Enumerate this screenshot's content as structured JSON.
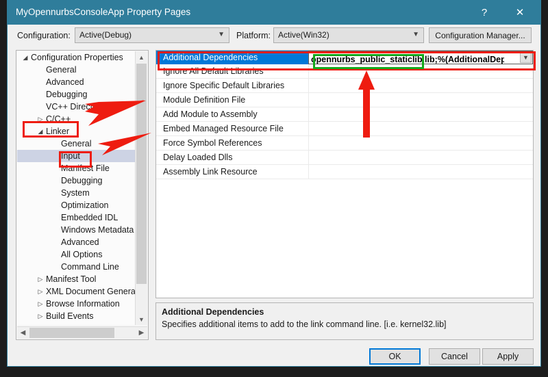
{
  "window": {
    "title": "MyOpennurbsConsoleApp Property Pages",
    "help_icon": "question-mark-icon",
    "close_icon": "close-x-icon"
  },
  "config_bar": {
    "configuration_label": "Configuration:",
    "configuration_value": "Active(Debug)",
    "platform_label": "Platform:",
    "platform_value": "Active(Win32)",
    "configuration_manager_button": "Configuration Manager...",
    "dropdown_icon": "chevron-down-icon"
  },
  "tree": {
    "items": [
      {
        "label": "Configuration Properties",
        "indent": 0,
        "expander": "expanded",
        "selected": false
      },
      {
        "label": "General",
        "indent": 1,
        "expander": "none",
        "selected": false
      },
      {
        "label": "Advanced",
        "indent": 1,
        "expander": "none",
        "selected": false
      },
      {
        "label": "Debugging",
        "indent": 1,
        "expander": "none",
        "selected": false
      },
      {
        "label": "VC++ Directories",
        "indent": 1,
        "expander": "none",
        "selected": false
      },
      {
        "label": "C/C++",
        "indent": 1,
        "expander": "collapsed",
        "selected": false
      },
      {
        "label": "Linker",
        "indent": 1,
        "expander": "expanded",
        "selected": false
      },
      {
        "label": "General",
        "indent": 2,
        "expander": "none",
        "selected": false
      },
      {
        "label": "Input",
        "indent": 2,
        "expander": "none",
        "selected": true
      },
      {
        "label": "Manifest File",
        "indent": 2,
        "expander": "none",
        "selected": false
      },
      {
        "label": "Debugging",
        "indent": 2,
        "expander": "none",
        "selected": false
      },
      {
        "label": "System",
        "indent": 2,
        "expander": "none",
        "selected": false
      },
      {
        "label": "Optimization",
        "indent": 2,
        "expander": "none",
        "selected": false
      },
      {
        "label": "Embedded IDL",
        "indent": 2,
        "expander": "none",
        "selected": false
      },
      {
        "label": "Windows Metadata",
        "indent": 2,
        "expander": "none",
        "selected": false
      },
      {
        "label": "Advanced",
        "indent": 2,
        "expander": "none",
        "selected": false
      },
      {
        "label": "All Options",
        "indent": 2,
        "expander": "none",
        "selected": false
      },
      {
        "label": "Command Line",
        "indent": 2,
        "expander": "none",
        "selected": false
      },
      {
        "label": "Manifest Tool",
        "indent": 1,
        "expander": "collapsed",
        "selected": false
      },
      {
        "label": "XML Document Genera",
        "indent": 1,
        "expander": "collapsed",
        "selected": false
      },
      {
        "label": "Browse Information",
        "indent": 1,
        "expander": "collapsed",
        "selected": false
      },
      {
        "label": "Build Events",
        "indent": 1,
        "expander": "collapsed",
        "selected": false
      }
    ],
    "expander_expanded_icon": "triangle-down-icon",
    "expander_collapsed_icon": "triangle-right-icon",
    "scroll_up_icon": "chevron-up-icon",
    "scroll_down_icon": "chevron-down-icon",
    "scroll_left_icon": "chevron-left-icon",
    "scroll_right_icon": "chevron-right-icon"
  },
  "grid": {
    "rows": [
      {
        "name": "Additional Dependencies",
        "value": "opennurbs_public_staticlib.lib;%(AdditionalDependencie",
        "selected": true
      },
      {
        "name": "Ignore All Default Libraries",
        "value": "",
        "selected": false
      },
      {
        "name": "Ignore Specific Default Libraries",
        "value": "",
        "selected": false
      },
      {
        "name": "Module Definition File",
        "value": "",
        "selected": false
      },
      {
        "name": "Add Module to Assembly",
        "value": "",
        "selected": false
      },
      {
        "name": "Embed Managed Resource File",
        "value": "",
        "selected": false
      },
      {
        "name": "Force Symbol References",
        "value": "",
        "selected": false
      },
      {
        "name": "Delay Loaded Dlls",
        "value": "",
        "selected": false
      },
      {
        "name": "Assembly Link Resource",
        "value": "",
        "selected": false
      }
    ],
    "value_dropdown_icon": "chevron-down-icon"
  },
  "description": {
    "title": "Additional Dependencies",
    "text": "Specifies additional items to add to the link command line. [i.e. kernel32.lib]"
  },
  "footer": {
    "ok_label": "OK",
    "cancel_label": "Cancel",
    "apply_label": "Apply"
  },
  "annotations": {
    "highlight_color": "#ee1c10",
    "value_highlight_color": "#14a81b"
  }
}
